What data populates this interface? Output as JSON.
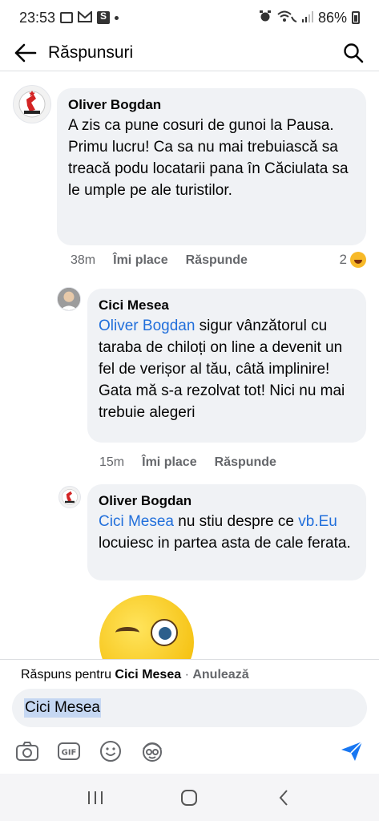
{
  "status_bar": {
    "time": "23:53",
    "battery": "86%"
  },
  "header": {
    "title": "Răspunsuri"
  },
  "comments": [
    {
      "author": "Oliver Bogdan",
      "text": "A zis ca pune cosuri de gunoi la Pausa.\nPrimu lucru! Ca sa nu mai trebuiască sa treacă podu locatarii pana în Căciulata sa le umple pe ale turistilor.",
      "time": "38m",
      "like_label": "Îmi place",
      "reply_label": "Răspunde",
      "reaction_count": "2"
    },
    {
      "author": "Cici Mesea",
      "mention": "Oliver Bogdan",
      "text": " sigur vânzătorul cu taraba de chiloți on line a devenit un fel de verișor al tău, câtă implinire! Gata mă s-a rezolvat tot! Nici nu mai trebuie alegeri",
      "time": "15m",
      "like_label": "Îmi place",
      "reply_label": "Răspunde"
    },
    {
      "author": "Oliver Bogdan",
      "mention": "Cici Mesea",
      "text_part1": " nu stiu despre ce ",
      "mention2": "vb.Eu",
      "text_part2": " locuiesc in partea asta de cale ferata."
    }
  ],
  "reply_panel": {
    "prefix": "Răspuns pentru ",
    "target": "Cici Mesea",
    "separator": " · ",
    "cancel_label": "Anulează",
    "input_value": "Cici Mesea"
  },
  "colors": {
    "mention": "#216fdb",
    "send": "#1877f2",
    "bubble": "#f0f2f5"
  }
}
